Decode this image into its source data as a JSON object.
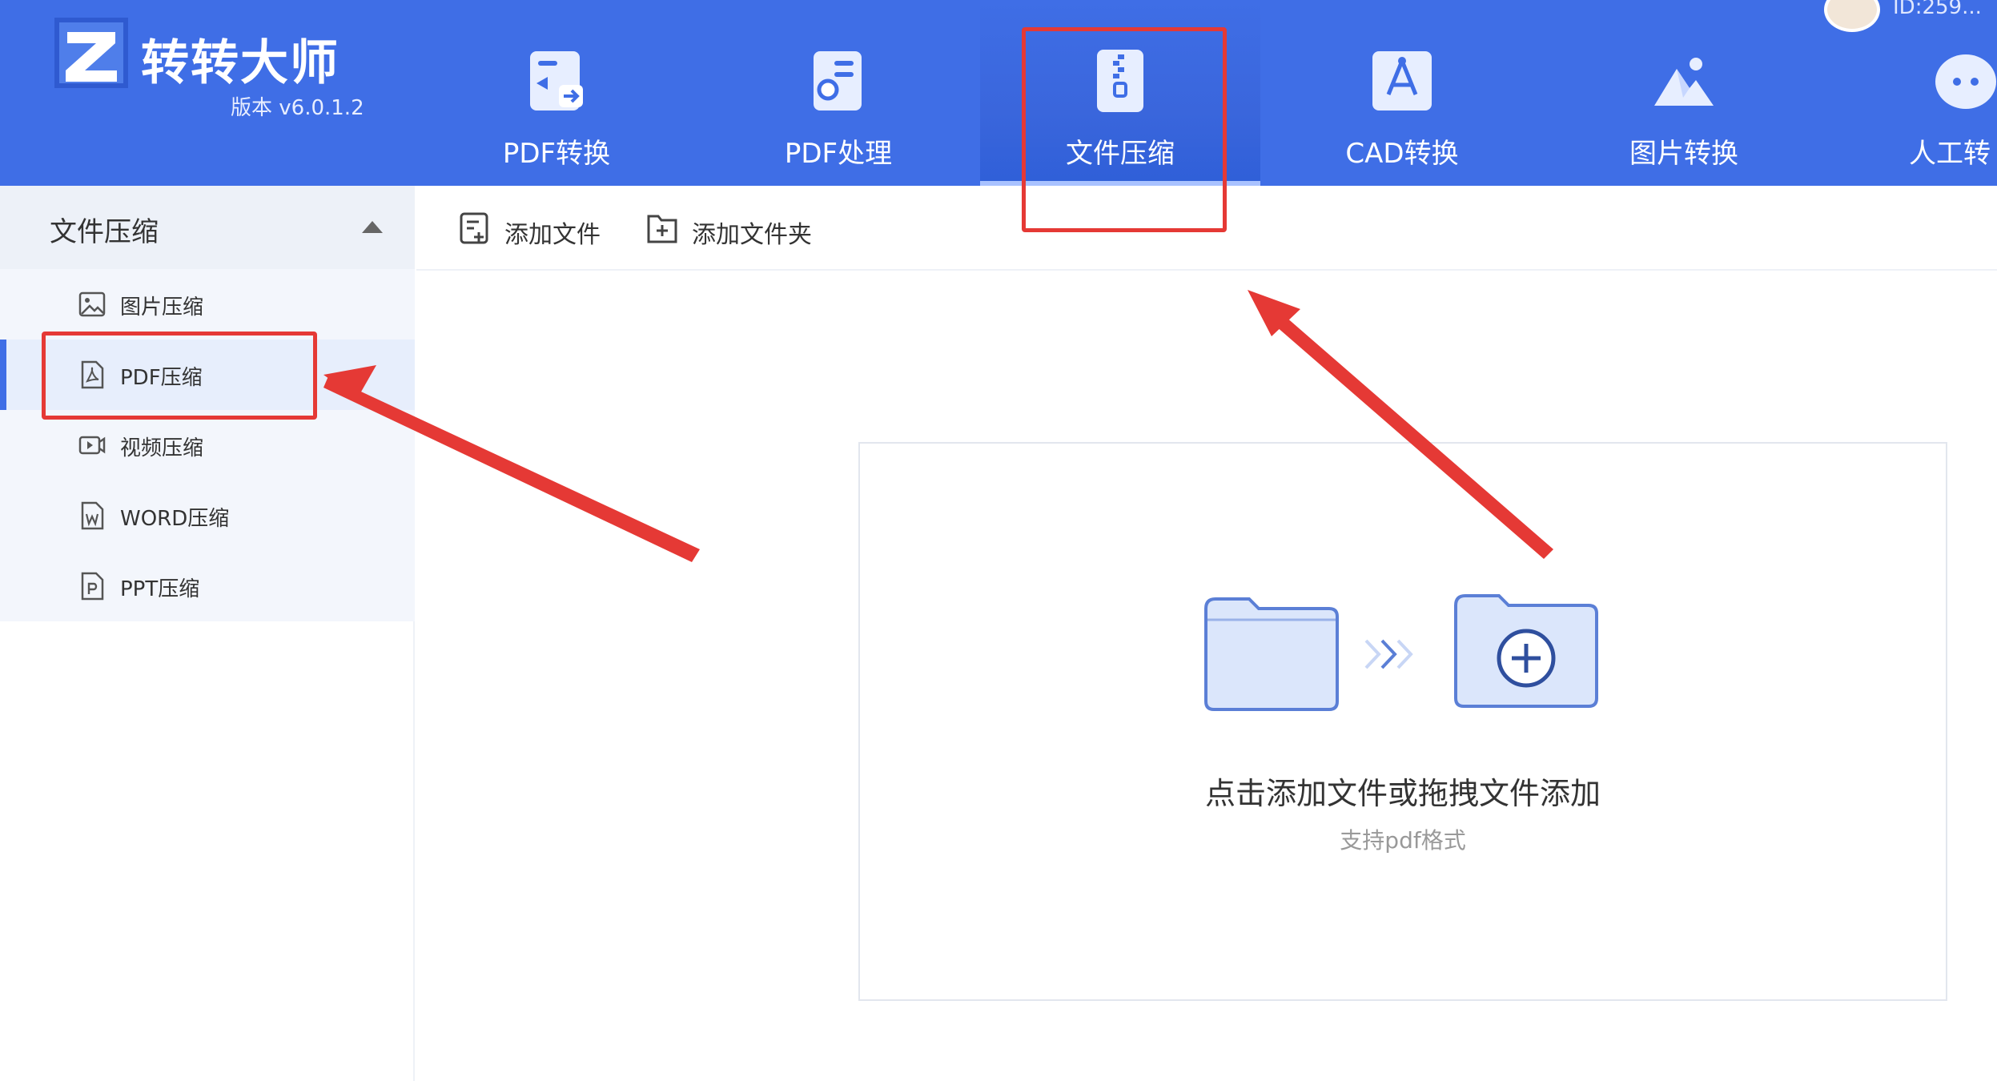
{
  "app": {
    "name": "转转大师",
    "version": "版本 v6.0.1.2",
    "user_id": "ID:259..."
  },
  "nav": {
    "tabs": [
      {
        "label": "PDF转换",
        "icon": "pdf-convert-icon"
      },
      {
        "label": "PDF处理",
        "icon": "pdf-process-icon"
      },
      {
        "label": "文件压缩",
        "icon": "zip-file-icon",
        "active": true
      },
      {
        "label": "CAD转换",
        "icon": "cad-icon"
      },
      {
        "label": "图片转换",
        "icon": "image-convert-icon"
      },
      {
        "label": "人工转",
        "icon": "chat-bot-icon"
      }
    ]
  },
  "sidebar": {
    "section_title": "文件压缩",
    "items": [
      {
        "label": "图片压缩",
        "icon": "image-icon"
      },
      {
        "label": "PDF压缩",
        "icon": "pdf-icon",
        "active": true
      },
      {
        "label": "视频压缩",
        "icon": "video-icon"
      },
      {
        "label": "WORD压缩",
        "icon": "word-icon"
      },
      {
        "label": "PPT压缩",
        "icon": "ppt-icon"
      }
    ]
  },
  "toolbar": {
    "add_file": "添加文件",
    "add_folder": "添加文件夹"
  },
  "dropzone": {
    "title": "点击添加文件或拖拽文件添加",
    "subtitle": "支持pdf格式"
  },
  "colors": {
    "header": "#3f6ee6",
    "annotation": "#e53935",
    "folder": "#dbe6fb",
    "folder_stroke": "#5b7fd6"
  }
}
